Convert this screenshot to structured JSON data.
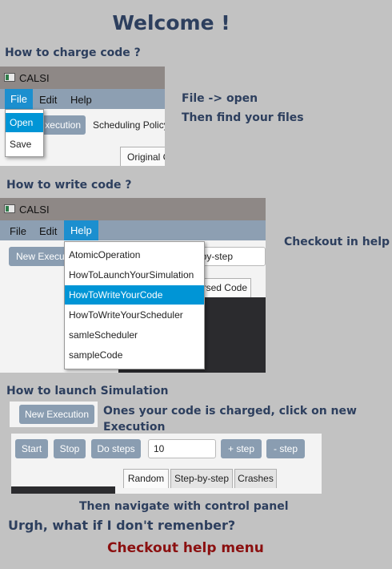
{
  "title": "Welcome !",
  "sections": {
    "charge": {
      "heading": "How to charge code ?",
      "instruction_line1": "File -> open",
      "instruction_line2": "Then find your files",
      "window_title": "CALSI",
      "menu": [
        "File",
        "Edit",
        "Help"
      ],
      "dropdown": [
        "Open",
        "Save"
      ],
      "button_partial": "xecution",
      "label_partial": "Scheduling Policy",
      "tab_partial": "Original C"
    },
    "write": {
      "heading": "How to write code ?",
      "instruction": "Checkout in help",
      "window_title": "CALSI",
      "menu": [
        "File",
        "Edit",
        "Help"
      ],
      "dropdown": [
        "AtomicOperation",
        "HowToLaunchYourSimulation",
        "HowToWriteYourCode",
        "HowToWriteYourScheduler",
        "samleScheduler",
        "sampleCode"
      ],
      "selected_index": 2,
      "button_partial": "New Executi",
      "field_partial": "ep-by-step",
      "tab_partial": "rsed Code"
    },
    "launch": {
      "heading": "How to launch Simulation",
      "new_execution": "New Execution",
      "instruction": "Ones your code is charged, click on new Execution",
      "controls": {
        "start": "Start",
        "stop": "Stop",
        "do_steps": "Do steps",
        "steps_value": "10",
        "plus_step": "+ step",
        "minus_step": "- step"
      },
      "tabs": [
        "Random",
        "Step-by-step",
        "Crashes"
      ],
      "navigate": "Then navigate with control panel"
    }
  },
  "question": "Urgh, what if I don't remenber?",
  "answer": "Checkout help menu",
  "colors": {
    "background": "#c2c2c2",
    "navy": "#2d3f5e",
    "answer_red": "#8b1010",
    "menubar": "#8d9fb2",
    "titlebar": "#8e8886",
    "selection": "#0095d6"
  }
}
